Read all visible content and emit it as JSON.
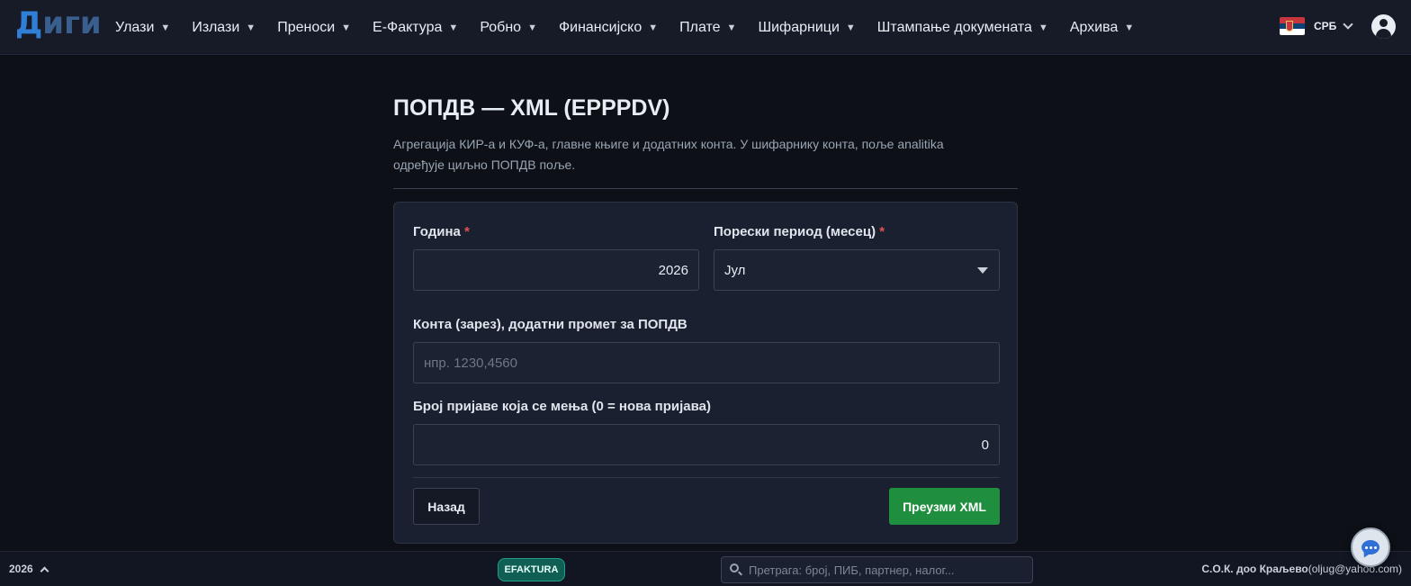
{
  "brand": {
    "logo_part1": "Д",
    "logo_part2": "иги"
  },
  "nav": {
    "items": [
      {
        "label": "Улази"
      },
      {
        "label": "Излази"
      },
      {
        "label": "Преноси"
      },
      {
        "label": "Е-Фактура"
      },
      {
        "label": "Робно"
      },
      {
        "label": "Финансијско"
      },
      {
        "label": "Плате"
      },
      {
        "label": "Шифарници"
      },
      {
        "label": "Штампање докумената"
      },
      {
        "label": "Архива"
      }
    ],
    "dropdown_glyph": "▼",
    "language": {
      "label": "СРБ",
      "flag": "serbia-flag-icon"
    },
    "user_icon": "user-circle-icon"
  },
  "page": {
    "title": "ПОПДВ — XML (EPPPDV)",
    "description_line1": "Агрегација КИР-а и КУФ-а, главне књиге и додатних конта. У шифарнику конта, поље analitika",
    "description_line2": "одређује циљно ПОПДВ поље."
  },
  "form": {
    "year": {
      "label": "Година",
      "required_mark": "*",
      "value": "2026"
    },
    "period": {
      "label": "Порески период (месец)",
      "required_mark": "*",
      "value": "Јул"
    },
    "accounts": {
      "label": "Конта (зарез), додатни промет за ПОПДВ",
      "value": "",
      "placeholder": "нпр. 1230,4560"
    },
    "amendment": {
      "label": "Број пријаве која се мења (0 = нова пријава)",
      "value": "0"
    },
    "back_label": "Назад",
    "download_label": "Преузми XML"
  },
  "footer": {
    "year": "2026",
    "efaktura_badge": "EFAKTURA",
    "search_placeholder": "Претрага: број, ПИБ, партнер, налог...",
    "company_name": "С.О.К. доо Краљево",
    "company_email": "(oljug@yahoo.com)"
  },
  "colors": {
    "background": "#0d1117",
    "navbar": "#161b27",
    "card": "#1b2030",
    "primary_button": "#1f8f3f",
    "required": "#e05252",
    "efaktura_badge": "#0f5f55",
    "logo_accent": "#2f7fd6"
  }
}
